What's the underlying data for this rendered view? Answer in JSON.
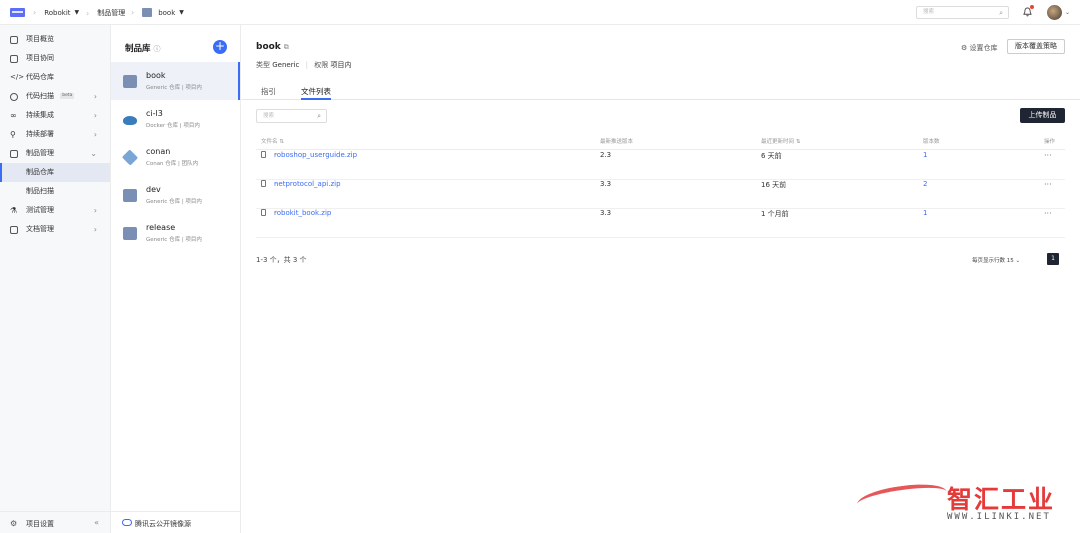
{
  "breadcrumb": {
    "project": "Robokit",
    "section": "制品管理",
    "repo": "book"
  },
  "top": {
    "search_placeholder": "搜索"
  },
  "sidebar": {
    "items": [
      {
        "label": "项目概览"
      },
      {
        "label": "项目协同"
      },
      {
        "label": "代码仓库"
      },
      {
        "label": "代码扫描",
        "badge": "beta"
      },
      {
        "label": "持续集成"
      },
      {
        "label": "持续部署"
      },
      {
        "label": "制品管理"
      },
      {
        "label": "制品仓库"
      },
      {
        "label": "制品扫描"
      },
      {
        "label": "测试管理"
      },
      {
        "label": "文档管理"
      }
    ],
    "footer": "项目设置"
  },
  "repos": {
    "title": "制品库",
    "items": [
      {
        "name": "book",
        "meta": "Generic 仓库 | 项目内"
      },
      {
        "name": "ci-l3",
        "meta": "Docker 仓库 | 项目内"
      },
      {
        "name": "conan",
        "meta": "Conan 仓库 | 团队内"
      },
      {
        "name": "dev",
        "meta": "Generic 仓库 | 项目内"
      },
      {
        "name": "release",
        "meta": "Generic 仓库 | 项目内"
      }
    ],
    "footer": "腾讯云公开镜像源"
  },
  "main": {
    "title": "book",
    "type_label": "类型",
    "type_value": "Generic",
    "perm_label": "权限",
    "perm_value": "项目内",
    "settings": "设置仓库",
    "policy": "版本覆盖策略",
    "tabs": [
      "指引",
      "文件列表"
    ],
    "filter_placeholder": "搜索",
    "upload": "上传制品",
    "columns": [
      "文件名",
      "最新推送版本",
      "最近更新时间",
      "版本数",
      "操作"
    ],
    "rows": [
      {
        "name": "roboshop_userguide.zip",
        "sub": "--",
        "version": "2.3",
        "time": "6 天前",
        "count": "1",
        "op": "···"
      },
      {
        "name": "netprotocol_api.zip",
        "sub": "--",
        "version": "3.3",
        "time": "16 天前",
        "count": "2",
        "op": "···"
      },
      {
        "name": "robokit_book.zip",
        "sub": "--",
        "version": "3.3",
        "time": "1 个月前",
        "count": "1",
        "op": "···"
      }
    ],
    "total": "1-3 个，共 3 个",
    "page_size": "每页显示行数 15",
    "page": "1"
  },
  "watermark": {
    "text": "智汇工业",
    "url": "WWW.ILINKI.NET"
  },
  "colors": {
    "accent": "#3b6cf5",
    "dark_button": "#1f2533",
    "watermark": "#e53a3a"
  }
}
